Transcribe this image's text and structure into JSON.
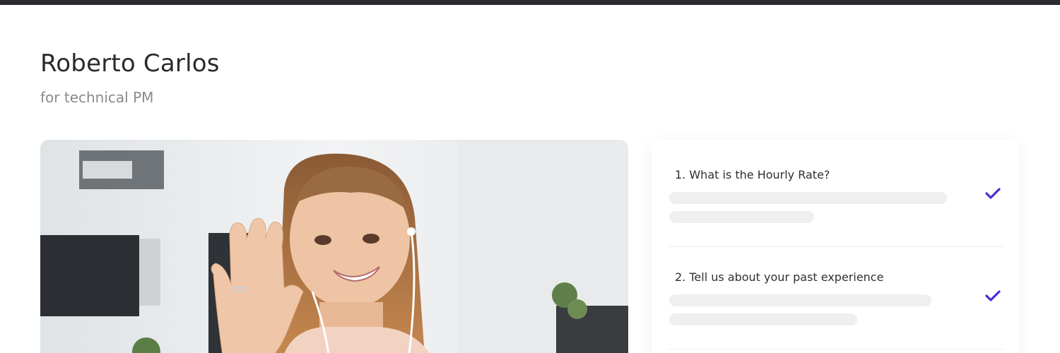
{
  "candidate": {
    "name": "Roberto Carlos",
    "subtitle": "for technical PM"
  },
  "video": {
    "subject": "woman waving with earphones in office"
  },
  "questions": [
    {
      "label": "1. What is the Hourly Rate?",
      "answered": true
    },
    {
      "label": "2. Tell us about your past experience",
      "answered": true
    }
  ],
  "colors": {
    "accent": "#4f2bd9",
    "topbar": "#2a2c2f"
  },
  "icons": {
    "answered": "check-icon"
  }
}
